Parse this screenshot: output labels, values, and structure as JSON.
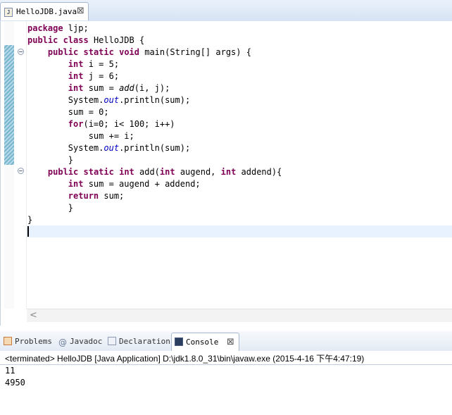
{
  "editor": {
    "tab": {
      "label": "HelloJDB.java",
      "icon": "J",
      "close": "⊠"
    },
    "code_lines": [
      [
        {
          "t": "package",
          "c": "kw"
        },
        {
          "t": " ljp;"
        }
      ],
      [
        {
          "t": "public",
          "c": "kw"
        },
        {
          "t": " "
        },
        {
          "t": "class",
          "c": "kw"
        },
        {
          "t": " HelloJDB {"
        }
      ],
      [
        {
          "t": "    "
        },
        {
          "t": "public",
          "c": "kw"
        },
        {
          "t": " "
        },
        {
          "t": "static",
          "c": "kw"
        },
        {
          "t": " "
        },
        {
          "t": "void",
          "c": "kw"
        },
        {
          "t": " main(String[] args) {"
        }
      ],
      [
        {
          "t": "        "
        },
        {
          "t": "int",
          "c": "kw"
        },
        {
          "t": " i = 5;"
        }
      ],
      [
        {
          "t": "        "
        },
        {
          "t": "int",
          "c": "kw"
        },
        {
          "t": " j = 6;"
        }
      ],
      [
        {
          "t": "        "
        },
        {
          "t": "int",
          "c": "kw"
        },
        {
          "t": " sum = "
        },
        {
          "t": "add",
          "c": "mcall"
        },
        {
          "t": "(i, j);"
        }
      ],
      [
        {
          "t": "        System."
        },
        {
          "t": "out",
          "c": "fld"
        },
        {
          "t": ".println(sum);"
        }
      ],
      [
        {
          "t": "        sum = 0;"
        }
      ],
      [
        {
          "t": "        "
        },
        {
          "t": "for",
          "c": "kw"
        },
        {
          "t": "(i=0; i< 100; i++)"
        }
      ],
      [
        {
          "t": "            sum += i;"
        }
      ],
      [
        {
          "t": "        System."
        },
        {
          "t": "out",
          "c": "fld"
        },
        {
          "t": ".println(sum);"
        }
      ],
      [
        {
          "t": "        }"
        }
      ],
      [
        {
          "t": "    "
        },
        {
          "t": "public",
          "c": "kw"
        },
        {
          "t": " "
        },
        {
          "t": "static",
          "c": "kw"
        },
        {
          "t": " "
        },
        {
          "t": "int",
          "c": "kw"
        },
        {
          "t": " add("
        },
        {
          "t": "int",
          "c": "kw"
        },
        {
          "t": " augend, "
        },
        {
          "t": "int",
          "c": "kw"
        },
        {
          "t": " addend){"
        }
      ],
      [
        {
          "t": "        "
        },
        {
          "t": "int",
          "c": "kw"
        },
        {
          "t": " sum = augend + addend;"
        }
      ],
      [
        {
          "t": "        "
        },
        {
          "t": "return",
          "c": "kw"
        },
        {
          "t": " sum;"
        }
      ],
      [
        {
          "t": "        }"
        }
      ],
      [
        {
          "t": "}"
        }
      ]
    ],
    "scroll_left_arrow": "<"
  },
  "panel": {
    "tabs": [
      {
        "label": "Problems",
        "icon": "problems-icon"
      },
      {
        "label": "Javadoc",
        "icon": "javadoc-icon",
        "glyph": "@"
      },
      {
        "label": "Declaration",
        "icon": "declaration-icon"
      },
      {
        "label": "Console",
        "icon": "console-icon",
        "active": true,
        "close": "⊠"
      }
    ],
    "console": {
      "title": "<terminated> HelloJDB [Java Application] D:\\jdk1.8.0_31\\bin\\javaw.exe (2015-4-16 下午4:47:19)",
      "output": [
        "11",
        "4950"
      ]
    }
  },
  "colors": {
    "keyword": "#7f0055",
    "field": "#0000c0",
    "current_line": "#e8f2fe"
  }
}
